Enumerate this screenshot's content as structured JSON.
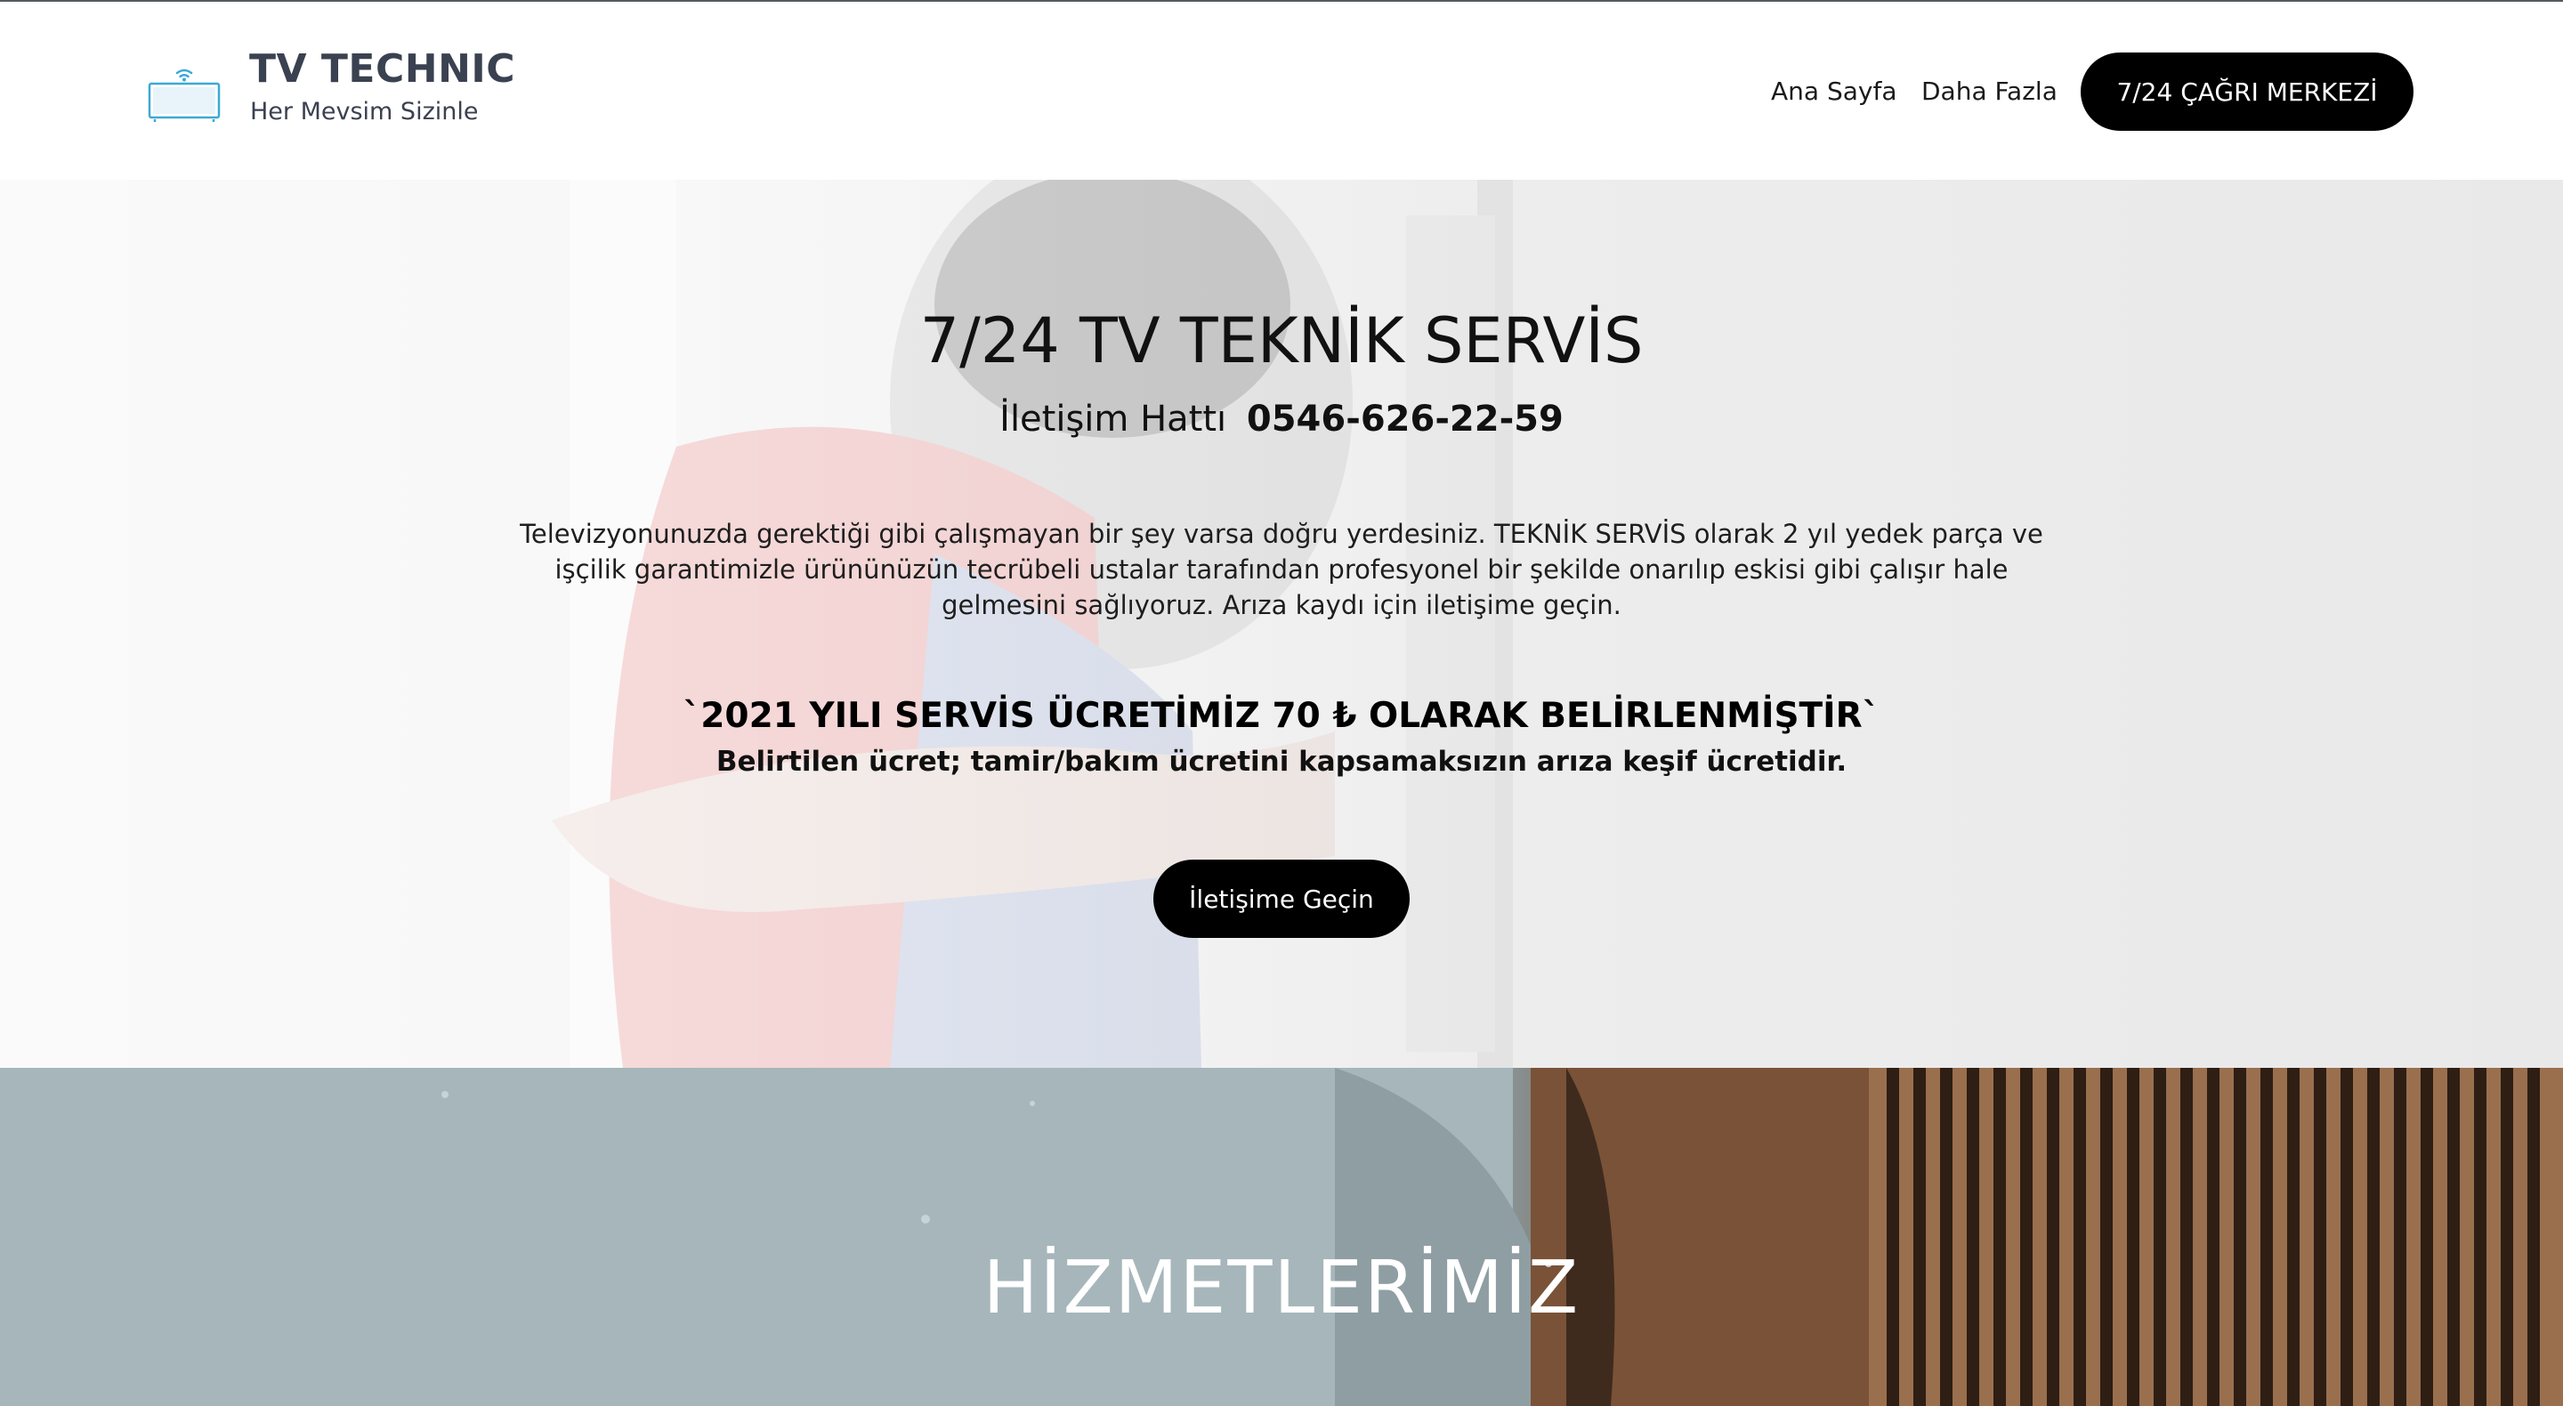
{
  "header": {
    "brand_title": "TV TECHNIC",
    "brand_subtitle": "Her Mevsim Sizinle",
    "logo_icon": "tv-wifi-icon",
    "nav": {
      "home": "Ana Sayfa",
      "more": "Daha Fazla",
      "call_center": "7/24 ÇAĞRI MERKEZİ"
    }
  },
  "hero": {
    "title": "7/24 TV TEKNİK SERVİS",
    "phone_label": "İletişim Hattı",
    "phone_number": "0546-626-22-59",
    "description": "Televizyonunuzda gerektiği gibi çalışmayan bir şey varsa doğru yerdesiniz. TEKNİK SERVİS olarak 2 yıl yedek parça ve işçilik garantimizle ürününüzün tecrübeli ustalar tarafından profesyonel bir şekilde onarılıp eskisi gibi çalışır hale gelmesini sağlıyoruz. Arıza kaydı için iletişime geçin.",
    "price_headline": "`2021 YILI SERVİS ÜCRETİMİZ 70 ₺ OLARAK BELİRLENMİŞTİR`",
    "price_note": "Belirtilen ücret; tamir/bakım ücretini kapsamaksızın arıza keşif ücretidir.",
    "contact_button": "İletişime Geçin"
  },
  "services": {
    "title": "HİZMETLERİMİZ"
  },
  "colors": {
    "button_bg": "#000000",
    "button_text": "#ffffff",
    "brand_text": "#3a4150",
    "logo_accent": "#3ba9d6"
  }
}
